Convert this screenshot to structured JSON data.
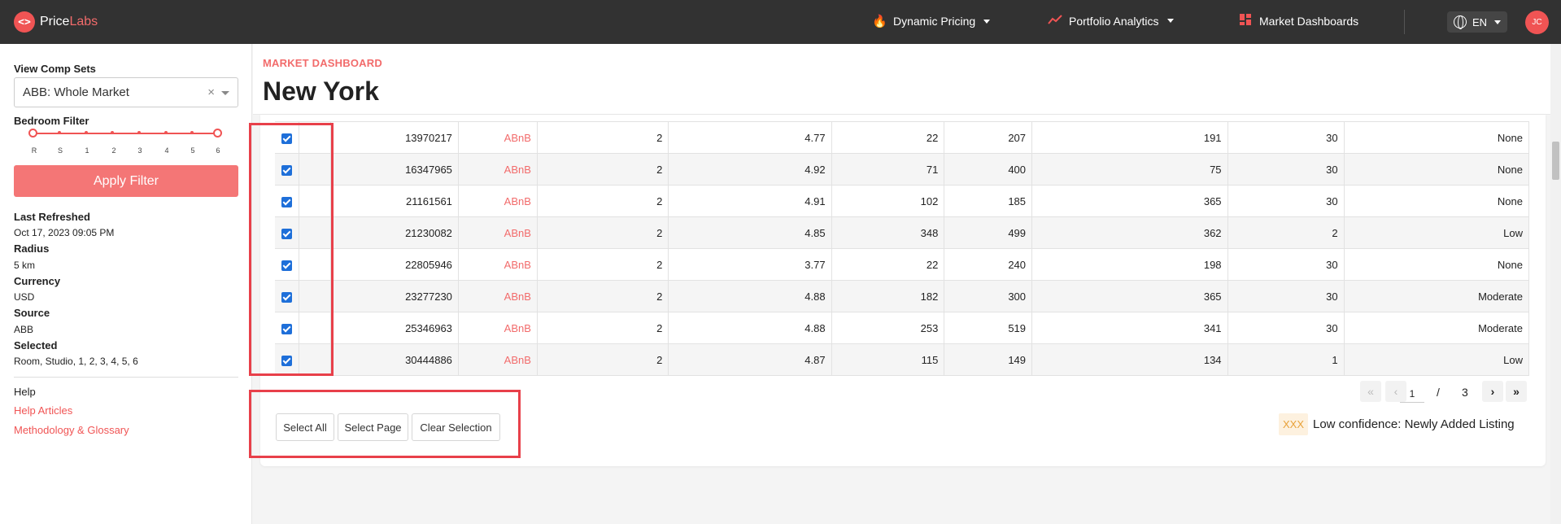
{
  "nav": {
    "logo_text_1": "Price",
    "logo_text_2": "Labs",
    "logo_mark": "<>",
    "items": [
      {
        "label": "Dynamic Pricing",
        "icon": "fire-icon"
      },
      {
        "label": "Portfolio Analytics",
        "icon": "chart-line-icon"
      },
      {
        "label": "Market Dashboards",
        "icon": "dashboard-icon"
      }
    ],
    "language": "EN",
    "avatar_initials": "JC"
  },
  "sidebar": {
    "comp_sets_label": "View Comp Sets",
    "comp_set_value": "ABB: Whole Market",
    "clear_glyph": "×",
    "bedroom_filter_label": "Bedroom Filter",
    "bedroom_ticks": [
      "R",
      "S",
      "1",
      "2",
      "3",
      "4",
      "5",
      "6"
    ],
    "apply_button": "Apply Filter",
    "info": [
      {
        "label": "Last Refreshed",
        "value": "Oct 17, 2023 09:05 PM"
      },
      {
        "label": "Radius",
        "value": "5 km"
      },
      {
        "label": "Currency",
        "value": "USD"
      },
      {
        "label": "Source",
        "value": "ABB"
      },
      {
        "label": "Selected",
        "value": "Room, Studio, 1, 2, 3, 4, 5, 6"
      }
    ],
    "help_label": "Help",
    "links": [
      "Help Articles",
      "Methodology & Glossary"
    ]
  },
  "header": {
    "eyebrow": "MARKET DASHBOARD",
    "title": "New York"
  },
  "table": {
    "rows": [
      {
        "id": "13970217",
        "source": "ABnB",
        "c1": "2",
        "rating": "4.77",
        "reviews": "22",
        "c2": "207",
        "c3": "191",
        "c4": "30",
        "status": "None"
      },
      {
        "id": "16347965",
        "source": "ABnB",
        "c1": "2",
        "rating": "4.92",
        "reviews": "71",
        "c2": "400",
        "c3": "75",
        "c4": "30",
        "status": "None"
      },
      {
        "id": "21161561",
        "source": "ABnB",
        "c1": "2",
        "rating": "4.91",
        "reviews": "102",
        "c2": "185",
        "c3": "365",
        "c4": "30",
        "status": "None"
      },
      {
        "id": "21230082",
        "source": "ABnB",
        "c1": "2",
        "rating": "4.85",
        "reviews": "348",
        "c2": "499",
        "c3": "362",
        "c4": "2",
        "status": "Low"
      },
      {
        "id": "22805946",
        "source": "ABnB",
        "c1": "2",
        "rating": "3.77",
        "reviews": "22",
        "c2": "240",
        "c3": "198",
        "c4": "30",
        "status": "None"
      },
      {
        "id": "23277230",
        "source": "ABnB",
        "c1": "2",
        "rating": "4.88",
        "reviews": "182",
        "c2": "300",
        "c3": "365",
        "c4": "30",
        "status": "Moderate"
      },
      {
        "id": "25346963",
        "source": "ABnB",
        "c1": "2",
        "rating": "4.88",
        "reviews": "253",
        "c2": "519",
        "c3": "341",
        "c4": "30",
        "status": "Moderate"
      },
      {
        "id": "30444886",
        "source": "ABnB",
        "c1": "2",
        "rating": "4.87",
        "reviews": "115",
        "c2": "149",
        "c3": "134",
        "c4": "1",
        "status": "Low"
      }
    ]
  },
  "pagination": {
    "current": "1",
    "separator": "/",
    "total": "3",
    "first_glyph": "«",
    "prev_glyph": "‹",
    "next_glyph": "›",
    "last_glyph": "»"
  },
  "selection": {
    "select_all": "Select All",
    "select_page": "Select Page",
    "clear_selection": "Clear Selection"
  },
  "legend": {
    "badge": "XXX",
    "text": "Low confidence: Newly Added Listing"
  },
  "colors": {
    "brand": "#f05454",
    "topbar": "#323232",
    "highlight": "#e8404a",
    "checkbox": "#1e6fd9"
  }
}
